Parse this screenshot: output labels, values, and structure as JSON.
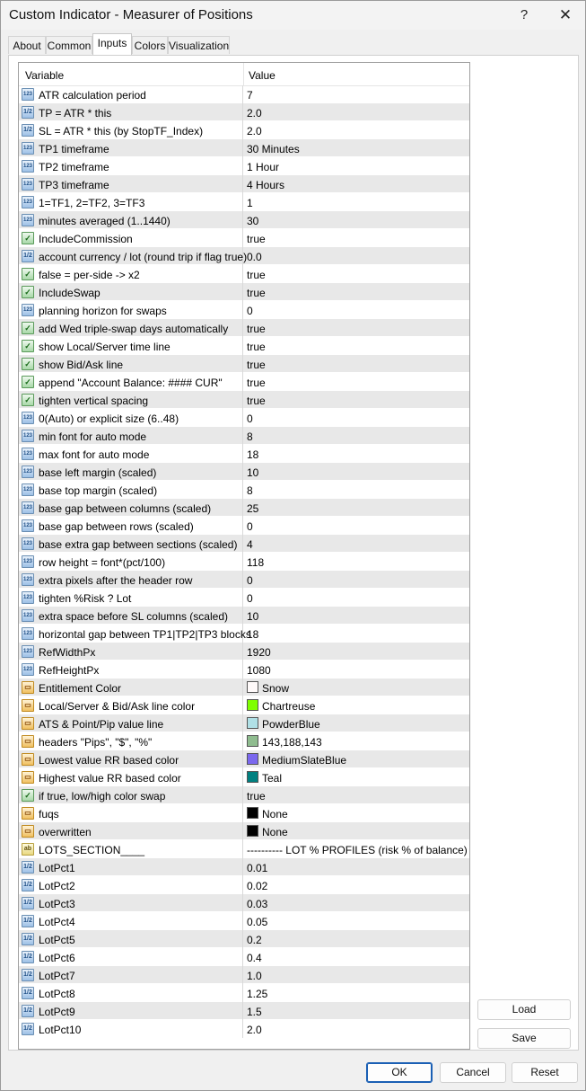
{
  "window": {
    "title": "Custom Indicator - Measurer of Positions",
    "help_glyph": "?",
    "close_glyph": "✕"
  },
  "tabs": [
    {
      "label": "About"
    },
    {
      "label": "Common"
    },
    {
      "label": "Inputs",
      "active": true
    },
    {
      "label": "Colors"
    },
    {
      "label": "Visualization"
    }
  ],
  "grid": {
    "col_variable": "Variable",
    "col_value": "Value",
    "rows": [
      {
        "type": "int",
        "name": "ATR calculation period",
        "value": "7"
      },
      {
        "type": "dbl",
        "name": "TP = ATR * this",
        "value": "2.0"
      },
      {
        "type": "dbl",
        "name": "SL = ATR * this (by StopTF_Index)",
        "value": "2.0"
      },
      {
        "type": "int",
        "name": "TP1 timeframe",
        "value": "30 Minutes"
      },
      {
        "type": "int",
        "name": "TP2 timeframe",
        "value": "1 Hour"
      },
      {
        "type": "int",
        "name": "TP3 timeframe",
        "value": "4 Hours"
      },
      {
        "type": "int",
        "name": "1=TF1, 2=TF2, 3=TF3",
        "value": "1"
      },
      {
        "type": "int",
        "name": "minutes averaged (1..1440)",
        "value": "30"
      },
      {
        "type": "bool",
        "name": "IncludeCommission",
        "value": "true"
      },
      {
        "type": "dbl",
        "name": "account currency / lot (round trip if flag true)",
        "value": "0.0"
      },
      {
        "type": "bool",
        "name": "false = per-side -> x2",
        "value": "true"
      },
      {
        "type": "bool",
        "name": "IncludeSwap",
        "value": "true"
      },
      {
        "type": "int",
        "name": "planning horizon for swaps",
        "value": "0"
      },
      {
        "type": "bool",
        "name": "add Wed triple-swap days automatically",
        "value": "true"
      },
      {
        "type": "bool",
        "name": "show Local/Server time line",
        "value": "true"
      },
      {
        "type": "bool",
        "name": "show Bid/Ask line",
        "value": "true"
      },
      {
        "type": "bool",
        "name": "append \"Account Balance: #### CUR\"",
        "value": "true"
      },
      {
        "type": "bool",
        "name": "tighten vertical spacing",
        "value": "true"
      },
      {
        "type": "int",
        "name": "0(Auto) or explicit size (6..48)",
        "value": "0"
      },
      {
        "type": "int",
        "name": "min font for auto mode",
        "value": "8"
      },
      {
        "type": "int",
        "name": "max font for auto mode",
        "value": "18"
      },
      {
        "type": "int",
        "name": "base left margin (scaled)",
        "value": "10"
      },
      {
        "type": "int",
        "name": "base top margin (scaled)",
        "value": "8"
      },
      {
        "type": "int",
        "name": "base gap between columns (scaled)",
        "value": "25"
      },
      {
        "type": "int",
        "name": "base gap between rows (scaled)",
        "value": "0"
      },
      {
        "type": "int",
        "name": "base extra gap between sections (scaled)",
        "value": "4"
      },
      {
        "type": "int",
        "name": "row height = font*(pct/100)",
        "value": "118"
      },
      {
        "type": "int",
        "name": "extra pixels after the header row",
        "value": "0"
      },
      {
        "type": "int",
        "name": "tighten %Risk ? Lot",
        "value": "0"
      },
      {
        "type": "int",
        "name": "extra space before SL columns (scaled)",
        "value": "10"
      },
      {
        "type": "int",
        "name": "horizontal gap between TP1|TP2|TP3 blocks",
        "value": "18"
      },
      {
        "type": "int",
        "name": "RefWidthPx",
        "value": "1920"
      },
      {
        "type": "int",
        "name": "RefHeightPx",
        "value": "1080"
      },
      {
        "type": "col",
        "name": "Entitlement Color",
        "value": "Snow",
        "swatch": "#fffafa"
      },
      {
        "type": "col",
        "name": "Local/Server & Bid/Ask line color",
        "value": "Chartreuse",
        "swatch": "#7fff00"
      },
      {
        "type": "col",
        "name": "ATS & Point/Pip value line",
        "value": "PowderBlue",
        "swatch": "#b0e0e6"
      },
      {
        "type": "col",
        "name": "headers \"Pips\", \"$\", \"%\"",
        "value": "143,188,143",
        "swatch": "#8fbc8f"
      },
      {
        "type": "col",
        "name": "Lowest value RR based color",
        "value": "MediumSlateBlue",
        "swatch": "#7b68ee"
      },
      {
        "type": "col",
        "name": "Highest value RR based color",
        "value": "Teal",
        "swatch": "#008080"
      },
      {
        "type": "bool",
        "name": "if true, low/high color swap",
        "value": "true"
      },
      {
        "type": "col",
        "name": "fuqs",
        "value": "None",
        "swatch": "#000000"
      },
      {
        "type": "col",
        "name": "overwritten",
        "value": "None",
        "swatch": "#000000"
      },
      {
        "type": "str",
        "name": "LOTS_SECTION____",
        "value": "---------- LOT % PROFILES (risk % of balance) ----------"
      },
      {
        "type": "dbl",
        "name": "LotPct1",
        "value": "0.01"
      },
      {
        "type": "dbl",
        "name": "LotPct2",
        "value": "0.02"
      },
      {
        "type": "dbl",
        "name": "LotPct3",
        "value": "0.03"
      },
      {
        "type": "dbl",
        "name": "LotPct4",
        "value": "0.05"
      },
      {
        "type": "dbl",
        "name": "LotPct5",
        "value": "0.2"
      },
      {
        "type": "dbl",
        "name": "LotPct6",
        "value": "0.4"
      },
      {
        "type": "dbl",
        "name": "LotPct7",
        "value": "1.0"
      },
      {
        "type": "dbl",
        "name": "LotPct8",
        "value": "1.25"
      },
      {
        "type": "dbl",
        "name": "LotPct9",
        "value": "1.5"
      },
      {
        "type": "dbl",
        "name": "LotPct10",
        "value": "2.0"
      }
    ]
  },
  "icons": {
    "int": "123",
    "dbl": "1/2",
    "bool": "✓",
    "col": "▭",
    "str": "ab"
  },
  "buttons": {
    "load": "Load",
    "save": "Save",
    "ok": "OK",
    "cancel": "Cancel",
    "reset": "Reset"
  }
}
